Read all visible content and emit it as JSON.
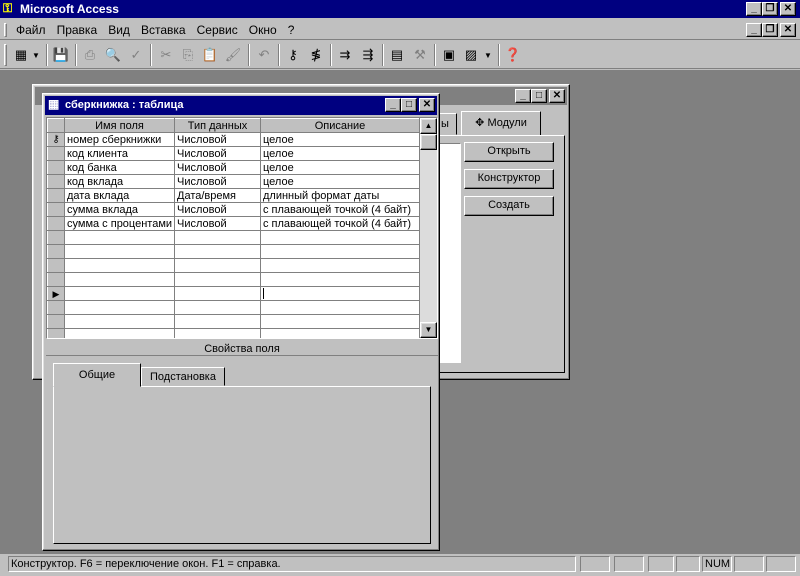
{
  "app": {
    "title": "Microsoft Access"
  },
  "menu": [
    {
      "label": "Файл"
    },
    {
      "label": "Правка"
    },
    {
      "label": "Вид"
    },
    {
      "label": "Вставка"
    },
    {
      "label": "Сервис"
    },
    {
      "label": "Окно"
    },
    {
      "label": "?"
    }
  ],
  "db_window": {
    "tabs": [
      {
        "label": "ы"
      },
      {
        "label": "Модули"
      }
    ],
    "buttons": {
      "open": "Открыть",
      "design": "Конструктор",
      "create": "Создать"
    }
  },
  "table_window": {
    "title": "сберкнижка : таблица",
    "headers": [
      "Имя поля",
      "Тип данных",
      "Описание"
    ],
    "rows": [
      {
        "name": "номер сберкнижки",
        "type": "Числовой",
        "desc": "целое"
      },
      {
        "name": "код клиента",
        "type": "Числовой",
        "desc": "целое"
      },
      {
        "name": "код банка",
        "type": "Числовой",
        "desc": "целое"
      },
      {
        "name": "код вклада",
        "type": "Числовой",
        "desc": "целое"
      },
      {
        "name": "дата вклада",
        "type": "Дата/время",
        "desc": "длинный формат даты"
      },
      {
        "name": "сумма вклада",
        "type": "Числовой",
        "desc": "с плавающей точкой (4 байт)"
      },
      {
        "name": "сумма с процентами",
        "type": "Числовой",
        "desc": "с плавающей точкой (4 байт)"
      }
    ],
    "properties_label": "Свойства поля",
    "property_tabs": [
      {
        "label": "Общие"
      },
      {
        "label": "Подстановка"
      }
    ]
  },
  "status": {
    "text": "Конструктор.  F6 = переключение окон.  F1 = справка.",
    "num": "NUM"
  }
}
